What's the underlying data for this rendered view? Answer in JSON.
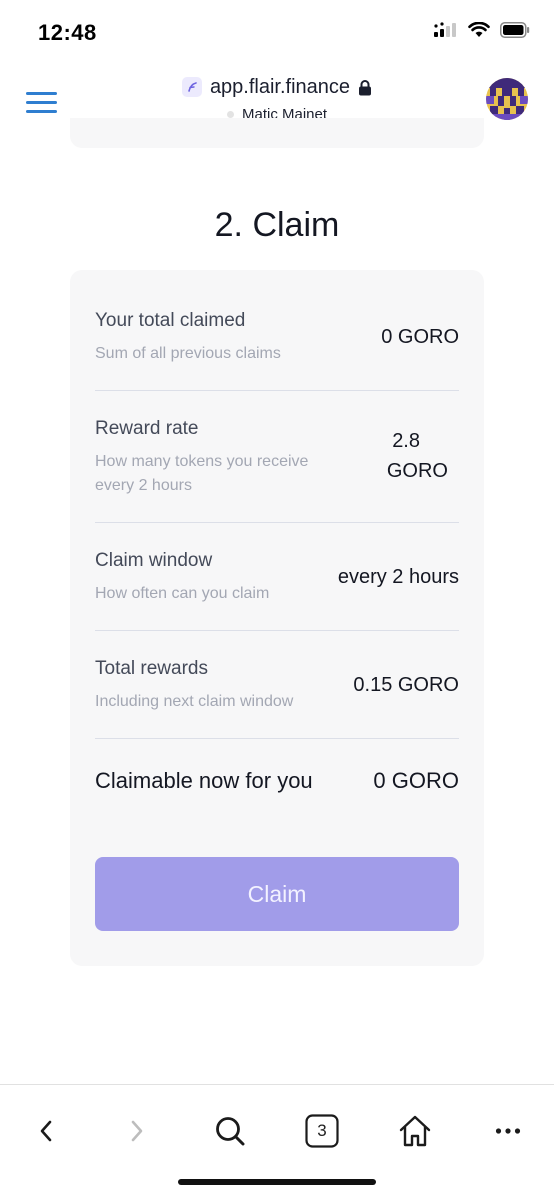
{
  "status_bar": {
    "time": "12:48"
  },
  "browser": {
    "url": "app.flair.finance",
    "network": "Matic Mainet"
  },
  "section": {
    "title": "2. Claim"
  },
  "claim": {
    "rows": [
      {
        "label": "Your total claimed",
        "sub": "Sum of all previous claims",
        "value": "0 GORO"
      },
      {
        "label": "Reward rate",
        "sub_line1": "How many tokens you receive",
        "sub_line2": "every 2 hours",
        "value_line1": "2.8",
        "value_line2": "GORO"
      },
      {
        "label": "Claim window",
        "sub": "How often can you claim",
        "value": "every 2 hours"
      },
      {
        "label": "Total rewards",
        "sub": "Including next claim window",
        "value": "0.15 GORO"
      }
    ],
    "claimable": {
      "label": "Claimable now for you",
      "value": "0 GORO"
    },
    "button_label": "Claim"
  },
  "toolbar": {
    "tab_count": "3"
  },
  "colors": {
    "menu_accent": "#2f7ed0",
    "claim_button": "#a19ce9",
    "card_background": "#f7f7f8"
  },
  "icons": {
    "status": [
      "cellular-signal-icon",
      "wifi-icon",
      "battery-icon"
    ],
    "header": [
      "menu-icon",
      "flair-logo-icon",
      "lock-icon",
      "avatar"
    ],
    "toolbar": [
      "back-icon",
      "forward-icon",
      "search-icon",
      "tabs-icon",
      "home-icon",
      "more-icon"
    ]
  }
}
